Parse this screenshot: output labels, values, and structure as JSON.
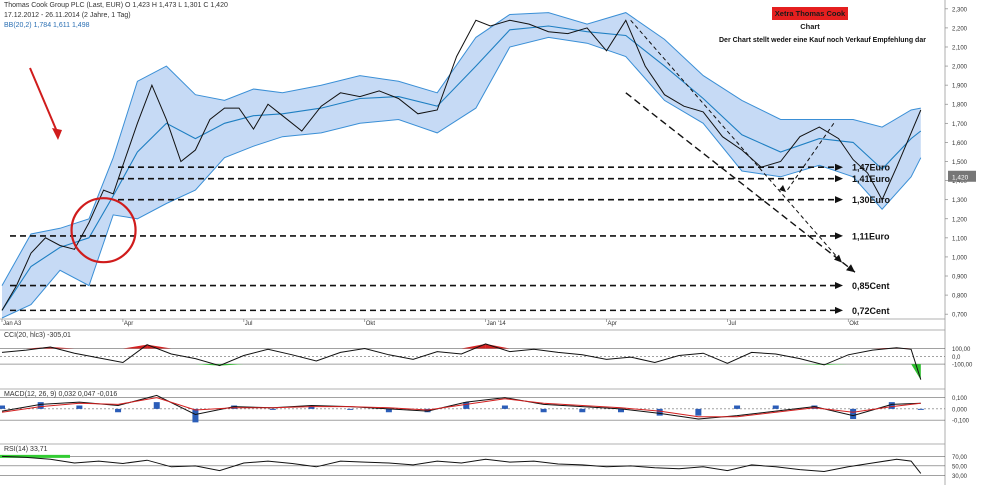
{
  "header": {
    "instrument": "Thomas Cook Group PLC (Last, EUR)  O 1,423  H 1,473  L 1,301  C 1,420",
    "period": "17.12.2012 - 26.11.2014 (2 Jahre, 1 Tag)",
    "bb_label": "BB(20,2)  1,784  1,611  1,498"
  },
  "annotations": {
    "badge": "Xetra Thomas Cook Chart",
    "disclaimer": "Der Chart stellt weder eine Kauf noch Verkauf Empfehlung dar",
    "levels": [
      {
        "label": "1,47Euro",
        "price": 1.47
      },
      {
        "label": "1,41Euro",
        "price": 1.41
      },
      {
        "label": "1,30Euro",
        "price": 1.3
      },
      {
        "label": "1,11Euro",
        "price": 1.11
      },
      {
        "label": "0,85Cent",
        "price": 0.85
      },
      {
        "label": "0,72Cent",
        "price": 0.72
      }
    ]
  },
  "chart_data": [
    {
      "type": "line",
      "panel": "price",
      "x_ticks": [
        "Jan A3",
        "Apr",
        "Jul",
        "Okt",
        "Jan '14",
        "Apr",
        "Jul",
        "Okt"
      ],
      "x_tick_pos": [
        0.0,
        0.25,
        0.5,
        0.75,
        1.0,
        1.25,
        1.5,
        1.75
      ],
      "xlim": [
        0,
        1.95
      ],
      "y_ticks": [
        "2,300",
        "2,200",
        "2,100",
        "2,000",
        "1,900",
        "1,800",
        "1,700",
        "1,600",
        "1,500",
        "1,400",
        "1,300",
        "1,200",
        "1,100",
        "1,000",
        "0,900",
        "0,800",
        "0,700"
      ],
      "y_tick_values": [
        2.3,
        2.2,
        2.1,
        2.0,
        1.9,
        1.8,
        1.7,
        1.6,
        1.5,
        1.4,
        1.3,
        1.2,
        1.1,
        1.0,
        0.9,
        0.8,
        0.7
      ],
      "ylim": [
        0.68,
        2.32
      ],
      "last_price_label": "1,420",
      "last_price": 1.42,
      "series": [
        {
          "name": "Thomas Cook Group PLC",
          "x": [
            0.0,
            0.03,
            0.06,
            0.09,
            0.12,
            0.15,
            0.18,
            0.21,
            0.23,
            0.25,
            0.28,
            0.31,
            0.34,
            0.37,
            0.4,
            0.43,
            0.46,
            0.49,
            0.52,
            0.55,
            0.58,
            0.62,
            0.66,
            0.7,
            0.74,
            0.78,
            0.82,
            0.86,
            0.9,
            0.94,
            0.98,
            1.01,
            1.05,
            1.09,
            1.13,
            1.17,
            1.21,
            1.25,
            1.29,
            1.33,
            1.37,
            1.41,
            1.45,
            1.49,
            1.53,
            1.57,
            1.61,
            1.65,
            1.69,
            1.73,
            1.76,
            1.79,
            1.82,
            1.85,
            1.88,
            1.9
          ],
          "y": [
            0.72,
            0.85,
            1.02,
            1.1,
            1.06,
            1.04,
            1.18,
            1.35,
            1.33,
            1.48,
            1.7,
            1.9,
            1.72,
            1.5,
            1.56,
            1.72,
            1.78,
            1.78,
            1.67,
            1.8,
            1.74,
            1.66,
            1.79,
            1.86,
            1.84,
            1.87,
            1.83,
            1.75,
            1.77,
            2.05,
            2.24,
            2.21,
            2.24,
            2.22,
            2.18,
            2.17,
            2.2,
            2.08,
            2.24,
            2.0,
            1.85,
            1.79,
            1.76,
            1.63,
            1.56,
            1.47,
            1.5,
            1.63,
            1.68,
            1.62,
            1.51,
            1.44,
            1.3,
            1.47,
            1.65,
            1.77
          ]
        },
        {
          "name": "BB Upper",
          "x": [
            0.0,
            0.06,
            0.12,
            0.18,
            0.23,
            0.28,
            0.34,
            0.4,
            0.46,
            0.52,
            0.58,
            0.66,
            0.74,
            0.82,
            0.9,
            0.98,
            1.05,
            1.13,
            1.21,
            1.29,
            1.37,
            1.45,
            1.53,
            1.61,
            1.69,
            1.76,
            1.82,
            1.88,
            1.9
          ],
          "y": [
            0.85,
            1.12,
            1.15,
            1.2,
            1.52,
            1.92,
            2.0,
            1.85,
            1.82,
            1.88,
            1.86,
            1.9,
            1.95,
            1.92,
            1.86,
            2.15,
            2.27,
            2.28,
            2.22,
            2.28,
            2.14,
            1.95,
            1.82,
            1.72,
            1.72,
            1.72,
            1.68,
            1.77,
            1.78
          ]
        },
        {
          "name": "BB Middle",
          "x": [
            0.0,
            0.06,
            0.12,
            0.18,
            0.23,
            0.28,
            0.34,
            0.4,
            0.46,
            0.52,
            0.58,
            0.66,
            0.74,
            0.82,
            0.9,
            0.98,
            1.05,
            1.13,
            1.21,
            1.29,
            1.37,
            1.45,
            1.53,
            1.61,
            1.69,
            1.76,
            1.82,
            1.88,
            1.9
          ],
          "y": [
            0.72,
            0.95,
            1.05,
            1.1,
            1.32,
            1.55,
            1.7,
            1.62,
            1.7,
            1.74,
            1.75,
            1.78,
            1.83,
            1.84,
            1.79,
            2.0,
            2.19,
            2.21,
            2.18,
            2.16,
            2.0,
            1.83,
            1.64,
            1.55,
            1.62,
            1.6,
            1.46,
            1.62,
            1.66
          ]
        },
        {
          "name": "BB Lower",
          "x": [
            0.0,
            0.06,
            0.12,
            0.18,
            0.23,
            0.28,
            0.34,
            0.4,
            0.46,
            0.52,
            0.58,
            0.66,
            0.74,
            0.82,
            0.9,
            0.98,
            1.05,
            1.13,
            1.21,
            1.29,
            1.37,
            1.45,
            1.53,
            1.61,
            1.69,
            1.76,
            1.82,
            1.88,
            1.9
          ],
          "y": [
            0.68,
            0.75,
            0.93,
            0.85,
            1.22,
            1.2,
            1.28,
            1.35,
            1.52,
            1.58,
            1.63,
            1.65,
            1.7,
            1.72,
            1.65,
            1.78,
            2.1,
            2.15,
            2.12,
            2.05,
            1.82,
            1.7,
            1.45,
            1.42,
            1.48,
            1.42,
            1.25,
            1.42,
            1.52
          ]
        }
      ]
    },
    {
      "type": "line",
      "panel": "indicator",
      "label": "CCI(20, hlc3)  -305,01",
      "ylim": [
        -305,
        300
      ],
      "y_ticks": [
        "100,00",
        "0,0",
        "-100,00"
      ],
      "y_tick_values": [
        100,
        0,
        -100
      ],
      "x": [
        0.0,
        0.05,
        0.1,
        0.15,
        0.2,
        0.25,
        0.3,
        0.35,
        0.4,
        0.45,
        0.5,
        0.55,
        0.6,
        0.65,
        0.7,
        0.75,
        0.8,
        0.85,
        0.9,
        0.95,
        1.0,
        1.05,
        1.1,
        1.15,
        1.2,
        1.25,
        1.3,
        1.35,
        1.4,
        1.45,
        1.5,
        1.55,
        1.6,
        1.65,
        1.7,
        1.75,
        1.8,
        1.85,
        1.88,
        1.9
      ],
      "values": [
        50,
        80,
        120,
        40,
        -20,
        -80,
        150,
        30,
        -30,
        -120,
        10,
        90,
        20,
        -60,
        50,
        100,
        20,
        -40,
        60,
        30,
        160,
        60,
        90,
        50,
        20,
        -40,
        -10,
        -80,
        10,
        40,
        -90,
        50,
        30,
        -30,
        -110,
        20,
        80,
        110,
        90,
        -305
      ]
    },
    {
      "type": "line",
      "panel": "indicator",
      "label": "MACD(12, 26, 9)  0,032  0,047  -0,016",
      "ylim": [
        -0.17,
        0.15
      ],
      "y_ticks": [
        "0,100",
        "0,000",
        "-0,100"
      ],
      "y_tick_values": [
        0.1,
        0.0,
        -0.1
      ],
      "series": [
        {
          "name": "MACD",
          "x": [
            0.0,
            0.08,
            0.16,
            0.24,
            0.32,
            0.4,
            0.48,
            0.56,
            0.64,
            0.72,
            0.8,
            0.88,
            0.96,
            1.04,
            1.12,
            1.2,
            1.28,
            1.36,
            1.44,
            1.52,
            1.6,
            1.68,
            1.76,
            1.84,
            1.9
          ],
          "values": [
            -0.02,
            0.04,
            0.06,
            0.03,
            0.12,
            -0.05,
            0.02,
            0.01,
            0.03,
            0.02,
            0.0,
            -0.02,
            0.06,
            0.1,
            0.04,
            0.02,
            0.0,
            -0.04,
            -0.09,
            -0.06,
            -0.02,
            0.02,
            -0.06,
            0.04,
            0.05
          ]
        },
        {
          "name": "Signal",
          "x": [
            0.0,
            0.08,
            0.16,
            0.24,
            0.32,
            0.4,
            0.48,
            0.56,
            0.64,
            0.72,
            0.8,
            0.88,
            0.96,
            1.04,
            1.12,
            1.2,
            1.28,
            1.36,
            1.44,
            1.52,
            1.6,
            1.68,
            1.76,
            1.84,
            1.9
          ],
          "values": [
            -0.03,
            0.02,
            0.05,
            0.04,
            0.1,
            -0.01,
            0.01,
            0.01,
            0.02,
            0.02,
            0.01,
            -0.01,
            0.04,
            0.09,
            0.05,
            0.03,
            0.01,
            -0.02,
            -0.07,
            -0.07,
            -0.03,
            0.01,
            -0.03,
            0.02,
            0.05
          ]
        }
      ]
    },
    {
      "type": "line",
      "panel": "indicator",
      "label": "RSI(14)  33,71",
      "ylim": [
        20,
        90
      ],
      "y_ticks": [
        "70,00",
        "50,00",
        "30,00"
      ],
      "y_tick_values": [
        70,
        50,
        30
      ],
      "x": [
        0.0,
        0.05,
        0.1,
        0.15,
        0.2,
        0.25,
        0.3,
        0.35,
        0.4,
        0.45,
        0.5,
        0.55,
        0.6,
        0.65,
        0.7,
        0.75,
        0.8,
        0.85,
        0.9,
        0.95,
        1.0,
        1.05,
        1.1,
        1.15,
        1.2,
        1.25,
        1.3,
        1.35,
        1.4,
        1.45,
        1.5,
        1.55,
        1.6,
        1.65,
        1.7,
        1.75,
        1.8,
        1.85,
        1.88,
        1.9
      ],
      "values": [
        70,
        68,
        64,
        56,
        60,
        55,
        62,
        48,
        50,
        40,
        56,
        60,
        55,
        48,
        60,
        58,
        56,
        52,
        60,
        56,
        64,
        58,
        60,
        54,
        52,
        48,
        50,
        46,
        44,
        48,
        40,
        52,
        48,
        42,
        38,
        48,
        56,
        64,
        60,
        34
      ]
    }
  ]
}
